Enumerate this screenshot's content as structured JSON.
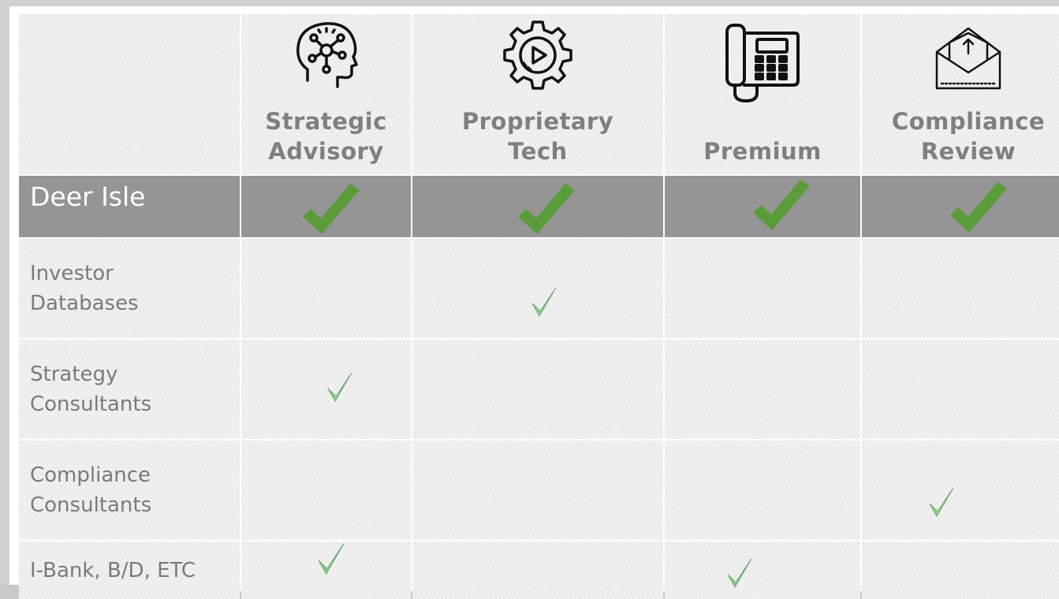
{
  "columns": [
    {
      "title": "Strategic\nAdvisory",
      "icon": "head-network-icon"
    },
    {
      "title": "Proprietary\nTech",
      "icon": "gear-play-icon"
    },
    {
      "title": "Premium",
      "icon": "desk-phone-icon"
    },
    {
      "title": "Compliance\nReview",
      "icon": "envelope-upload-icon"
    }
  ],
  "rows": [
    {
      "label": "Deer Isle",
      "highlight": true,
      "checks": [
        true,
        true,
        true,
        true
      ]
    },
    {
      "label": "Investor\nDatabases",
      "highlight": false,
      "checks": [
        false,
        true,
        false,
        false
      ]
    },
    {
      "label": "Strategy\nConsultants",
      "highlight": false,
      "checks": [
        true,
        false,
        false,
        false
      ]
    },
    {
      "label": "Compliance\nConsultants",
      "highlight": false,
      "checks": [
        false,
        false,
        false,
        true
      ]
    },
    {
      "label": "I-Bank, B/D, ETC",
      "highlight": false,
      "checks": [
        true,
        false,
        true,
        false
      ]
    }
  ],
  "colors": {
    "highlight_row": "#959595",
    "big_check": "#5a9b3a",
    "small_check": "#8fcf8a",
    "header_text": "#7f7f7f"
  }
}
